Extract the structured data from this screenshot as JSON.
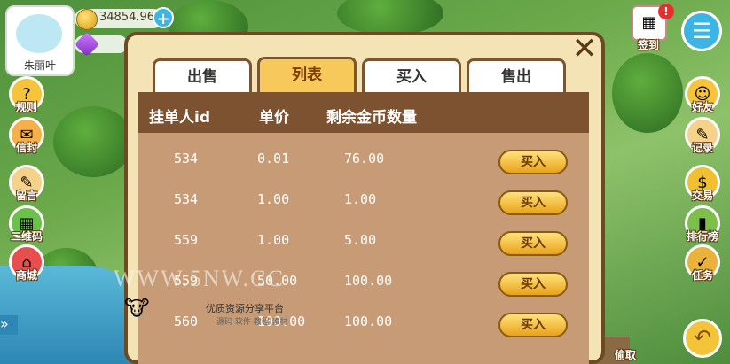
{
  "player": {
    "name": "朱丽叶",
    "coins": "34854.96"
  },
  "left_menu": [
    {
      "label": "规则",
      "icon": "rules-icon",
      "glyph": "?",
      "color": "#f6c43a"
    },
    {
      "label": "信封",
      "icon": "envelope-icon",
      "glyph": "✉",
      "color": "#f5b04a"
    },
    {
      "label": "留言",
      "icon": "message-icon",
      "glyph": "✎",
      "color": "#f4d28a"
    },
    {
      "label": "二维码",
      "icon": "qrcode-icon",
      "glyph": "▦",
      "color": "#6cc14a"
    },
    {
      "label": "商城",
      "icon": "shop-icon",
      "glyph": "⌂",
      "color": "#e94e4e"
    }
  ],
  "right_menu": [
    {
      "label": "好友",
      "icon": "friends-icon",
      "glyph": "☺",
      "color": "#f6c43a"
    },
    {
      "label": "记录",
      "icon": "record-icon",
      "glyph": "✎",
      "color": "#f4d28a"
    },
    {
      "label": "交易",
      "icon": "trade-icon",
      "glyph": "$",
      "color": "#f0c030"
    },
    {
      "label": "排行榜",
      "icon": "ranking-icon",
      "glyph": "▮",
      "color": "#7cc04a"
    },
    {
      "label": "任务",
      "icon": "task-icon",
      "glyph": "✓",
      "color": "#e9b23a"
    }
  ],
  "checkin": {
    "label": "签到",
    "badge": "!"
  },
  "steal": {
    "label": "偷取"
  },
  "tabs": [
    "出售",
    "列表",
    "买入",
    "售出"
  ],
  "active_tab": 1,
  "table": {
    "headers": [
      "挂单人id",
      "单价",
      "剩余金币数量"
    ],
    "rows": [
      {
        "id": "534",
        "price": "0.01",
        "amount": "76.00",
        "action": "买入"
      },
      {
        "id": "534",
        "price": "1.00",
        "amount": "1.00",
        "action": "买入"
      },
      {
        "id": "559",
        "price": "1.00",
        "amount": "5.00",
        "action": "买入"
      },
      {
        "id": "559",
        "price": "50.00",
        "amount": "100.00",
        "action": "买入"
      },
      {
        "id": "560",
        "price": "100.00",
        "amount": "100.00",
        "action": "买入"
      }
    ]
  },
  "watermark": {
    "text": "WWW.5NW.CC",
    "sub": "优质资源分享平台",
    "sub2": "源码 软件 教程 素材"
  },
  "close_glyph": "✕",
  "menu_glyph": "☰",
  "back_glyph": "↶",
  "expand_glyph": "»"
}
